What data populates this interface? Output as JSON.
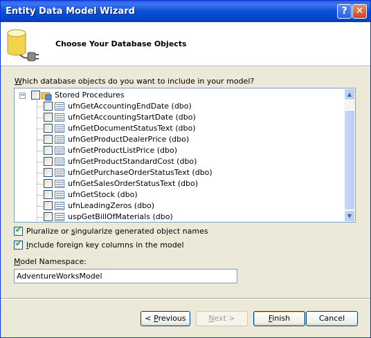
{
  "window": {
    "title": "Entity Data Model Wizard",
    "help_label": "?",
    "close_label": "✕"
  },
  "header": {
    "title": "Choose Your Database Objects",
    "icon": "database-plug-icon"
  },
  "prompt": {
    "prefix": "W",
    "rest": "hich database objects do you want to include in your model?"
  },
  "tree": {
    "root": {
      "label": "Stored Procedures",
      "expander": "−"
    },
    "items": [
      "ufnGetAccountingEndDate (dbo)",
      "ufnGetAccountingStartDate (dbo)",
      "ufnGetDocumentStatusText (dbo)",
      "ufnGetProductDealerPrice (dbo)",
      "ufnGetProductListPrice (dbo)",
      "ufnGetProductStandardCost (dbo)",
      "ufnGetPurchaseOrderStatusText (dbo)",
      "ufnGetSalesOrderStatusText (dbo)",
      "ufnGetStock (dbo)",
      "ufnLeadingZeros (dbo)",
      "uspGetBillOfMaterials (dbo)"
    ],
    "scroll_up": "▲",
    "scroll_down": "▼"
  },
  "options": {
    "pluralize": {
      "a": "Pluralize or ",
      "u": "s",
      "b": "ingularize generated object names",
      "checked": true
    },
    "foreign_keys": {
      "u": "I",
      "b": "nclude foreign key columns in the model",
      "checked": true
    }
  },
  "namespace": {
    "label_u": "M",
    "label_rest": "odel Namespace:",
    "value": "AdventureWorksModel"
  },
  "buttons": {
    "previous": {
      "a": "< ",
      "u": "P",
      "b": "revious"
    },
    "next": {
      "u": "N",
      "b": "ext >"
    },
    "finish": {
      "u": "F",
      "b": "inish"
    },
    "cancel": "Cancel"
  },
  "colors": {
    "title_bar": "#0545c8",
    "dialog_bg": "#ece9d8",
    "check_mark": "#21a121"
  }
}
